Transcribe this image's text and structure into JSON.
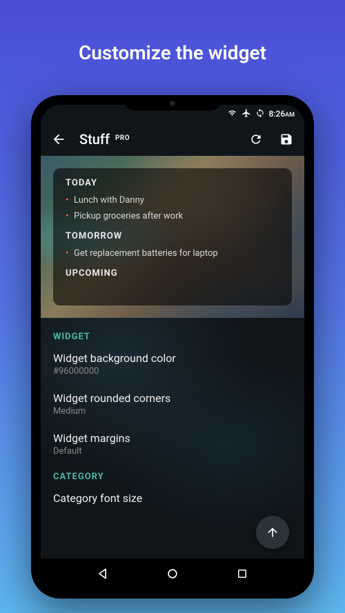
{
  "page": {
    "title": "Customize the widget"
  },
  "status": {
    "time": "8:26",
    "ampm": "AM"
  },
  "appbar": {
    "title": "Stuff",
    "badge": "PRO"
  },
  "widget": {
    "sections": [
      {
        "title": "TODAY",
        "items": [
          "Lunch with Danny",
          "Pickup groceries after work"
        ]
      },
      {
        "title": "TOMORROW",
        "items": [
          "Get replacement batteries for laptop"
        ]
      },
      {
        "title": "UPCOMING",
        "items": []
      }
    ]
  },
  "settings": {
    "sections": [
      {
        "header": "WIDGET",
        "items": [
          {
            "title": "Widget background color",
            "value": "#96000000"
          },
          {
            "title": "Widget rounded corners",
            "value": "Medium"
          },
          {
            "title": "Widget margins",
            "value": "Default"
          }
        ]
      },
      {
        "header": "CATEGORY",
        "items": [
          {
            "title": "Category font size",
            "value": ""
          }
        ]
      }
    ]
  }
}
